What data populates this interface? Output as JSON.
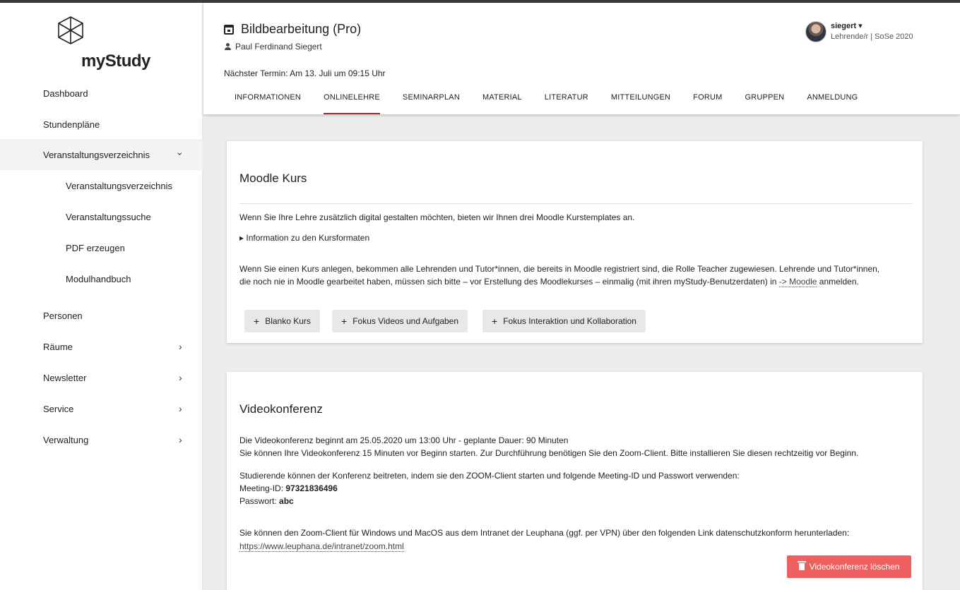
{
  "app": {
    "logo_text": "myStudy"
  },
  "sidebar": {
    "items": [
      {
        "label": "Dashboard"
      },
      {
        "label": "Stundenpläne"
      },
      {
        "label": "Veranstaltungsverzeichnis",
        "expanded": true,
        "icon": "chevron-down-icon"
      },
      {
        "label": "Veranstaltungsverzeichnis",
        "sub": true
      },
      {
        "label": "Veranstaltungssuche",
        "sub": true
      },
      {
        "label": "PDF erzeugen",
        "sub": true
      },
      {
        "label": "Modulhandbuch",
        "sub": true
      },
      {
        "label": "Personen"
      },
      {
        "label": "Räume",
        "icon": "chevron-right-icon"
      },
      {
        "label": "Newsletter",
        "icon": "chevron-right-icon"
      },
      {
        "label": "Service",
        "icon": "chevron-right-icon"
      },
      {
        "label": "Verwaltung",
        "icon": "chevron-right-icon"
      }
    ]
  },
  "header": {
    "course_title": "Bildbearbeitung (Pro)",
    "lecturer": "Paul Ferdinand Siegert",
    "next_date": "Nächster Termin: Am 13. Juli um 09:15 Uhr",
    "user": {
      "name": "siegert ▾",
      "role": "Lehrende/r | SoSe 2020"
    },
    "tabs": [
      {
        "label": "INFORMATIONEN"
      },
      {
        "label": "ONLINELEHRE",
        "active": true
      },
      {
        "label": "SEMINARPLAN"
      },
      {
        "label": "MATERIAL"
      },
      {
        "label": "LITERATUR"
      },
      {
        "label": "MITTEILUNGEN"
      },
      {
        "label": "FORUM"
      },
      {
        "label": "GRUPPEN"
      },
      {
        "label": "ANMELDUNG"
      }
    ]
  },
  "moodle": {
    "title": "Moodle Kurs",
    "intro": "Wenn Sie Ihre Lehre zusätzlich digital gestalten möchten, bieten wir Ihnen drei Moodle Kurstemplates an.",
    "details": "▸ Information zu den Kursformaten",
    "para1_line1": "Wenn Sie einen Kurs anlegen, bekommen alle Lehrenden und Tutor*innen, die bereits in Moodle registriert sind, die Rolle Teacher zugewiesen. Lehrende und Tutor*innen,",
    "para1_line2_pre": "die noch nie in Moodle gearbeitet haben, müssen sich bitte – vor Erstellung des Moodlekurses – einmalig (mit ihren myStudy-Benutzerdaten) in ",
    "para1_link": "-> Moodle",
    "para1_line2_post": " anmelden.",
    "buttons": [
      {
        "label": "Blanko Kurs"
      },
      {
        "label": "Fokus Videos und Aufgaben"
      },
      {
        "label": "Fokus Interaktion und Kollaboration"
      }
    ]
  },
  "video": {
    "title": "Videokonferenz",
    "line1": "Die Videokonferenz beginnt am 25.05.2020 um 13:00 Uhr - geplante Dauer: 90 Minuten",
    "line2": "Sie können Ihre Videokonferenz 15 Minuten vor Beginn starten. Zur Durchführung benötigen Sie den Zoom-Client. Bitte installieren Sie diesen rechtzeitig vor Beginn.",
    "line3": "Studierende können der Konferenz beitreten, indem sie den ZOOM-Client starten und folgende Meeting-ID und Passwort verwenden:",
    "meeting_label": "Meeting-ID: ",
    "meeting_id": "97321836496",
    "password_label": "Passwort: ",
    "password": "abc",
    "line4": "Sie können den Zoom-Client für Windows und MacOS aus dem Intranet der Leuphana (ggf. per VPN) über den folgenden Link datenschutzkonform herunterladen:",
    "link": "https://www.leuphana.de/intranet/zoom.html",
    "delete_label": "Videokonferenz löschen"
  },
  "colors": {
    "accent": "#a8242f",
    "danger": "#ef5f5f"
  }
}
